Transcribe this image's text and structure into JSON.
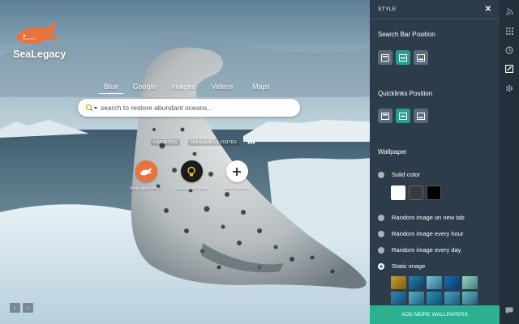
{
  "brand": {
    "name": "SeaLegacy",
    "logo_icon": "whale-logo-icon",
    "accent": "#e9733c"
  },
  "search": {
    "tabs": [
      {
        "label": "Blue",
        "active": true
      },
      {
        "label": "Google",
        "active": false
      },
      {
        "label": "Images",
        "active": false
      },
      {
        "label": "Videos",
        "active": false
      },
      {
        "label": "Maps",
        "active": false
      }
    ],
    "placeholder": "search to restore abundant oceans..."
  },
  "quicklinks": {
    "tabs": [
      "FAVORITES",
      "FREQUENTLY VISITED"
    ],
    "more": "•••",
    "items": [
      {
        "label": "SeaLegacy We...",
        "icon": "whale-icon",
        "color": "#e9733c"
      },
      {
        "label": "SeaLegacy Store",
        "icon": "lightbulb-icon",
        "color": "#1b1b1b"
      },
      {
        "label": "Add shortcut",
        "icon": "plus-icon",
        "color": "#ffffff"
      }
    ]
  },
  "panel": {
    "title": "STYLE",
    "search_bar_position": "Search Bar Position",
    "quicklinks_position": "Quicklinks Position",
    "wallpaper": "Wallpaper",
    "options": {
      "solid": "Solid color",
      "new_tab": "Random image on new tab",
      "hour": "Random image every hour",
      "day": "Random image every day",
      "static": "Static image"
    },
    "selected_option": "static",
    "swatches": [
      "#ffffff",
      "#3a3a3a",
      "#000000"
    ],
    "add_button": "ADD MORE WALLPAPERS",
    "accent": "#2bb091"
  },
  "rail_icons": [
    "rss-icon",
    "apps-grid-icon",
    "clock-icon",
    "style-icon",
    "gear-icon",
    "chat-icon"
  ]
}
